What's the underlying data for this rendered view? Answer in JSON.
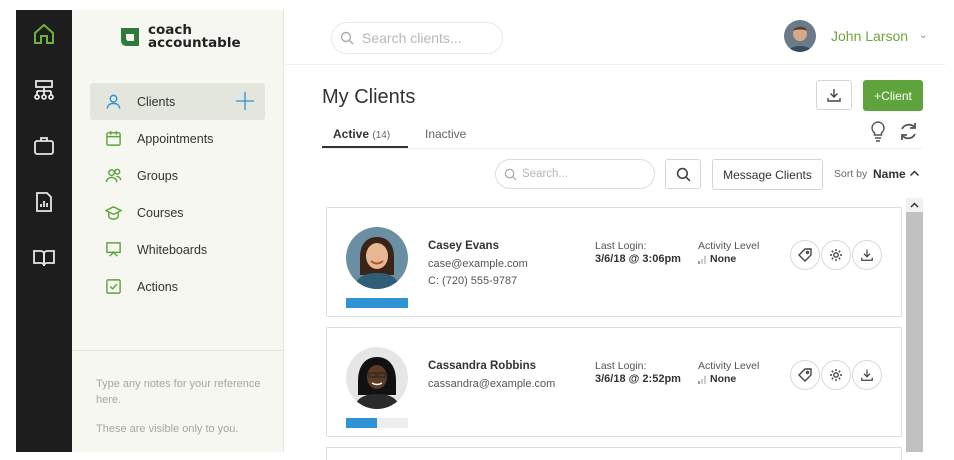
{
  "colors": {
    "accent": "#5ea33b",
    "rail": "#1d1d1d",
    "sidebar": "#f5f7f0",
    "progress": "#2d93d4",
    "user_name": "#6fa43e"
  },
  "brand": {
    "name": "coach\naccountable",
    "icon": "coachaccountable-logo-icon"
  },
  "rail": {
    "icons": [
      "home-icon",
      "org-chart-icon",
      "briefcase-icon",
      "report-icon",
      "book-icon"
    ]
  },
  "sidebar": {
    "items": [
      {
        "label": "Clients",
        "icon": "user-icon",
        "active": true
      },
      {
        "label": "Appointments",
        "icon": "calendar-icon"
      },
      {
        "label": "Groups",
        "icon": "group-icon"
      },
      {
        "label": "Courses",
        "icon": "graduation-cap-icon"
      },
      {
        "label": "Whiteboards",
        "icon": "whiteboard-icon"
      },
      {
        "label": "Actions",
        "icon": "checkbox-icon"
      }
    ],
    "notes_placeholder": "Type any notes for your reference here.",
    "notes_visibility": "These are visible only to you."
  },
  "header": {
    "search_placeholder": "Search clients...",
    "user_name": "John Larson"
  },
  "main": {
    "title": "My Clients",
    "add_client_label": "+Client",
    "tabs": [
      {
        "label": "Active",
        "count": "(14)",
        "active": true
      },
      {
        "label": "Inactive"
      }
    ],
    "list_search_placeholder": "Search...",
    "message_clients_label": "Message Clients",
    "sort_by_label": "Sort by",
    "sort_value": "Name"
  },
  "clients": [
    {
      "name": "Casey Evans",
      "email": "case@example.com",
      "phone": "C: (720) 555-9787",
      "last_login_label": "Last Login:",
      "last_login": "3/6/18 @ 3:06pm",
      "activity_label": "Activity Level",
      "activity": "None",
      "progress": 1.0
    },
    {
      "name": "Cassandra Robbins",
      "email": "cassandra@example.com",
      "phone": "",
      "last_login_label": "Last Login:",
      "last_login": "3/6/18 @ 2:52pm",
      "activity_label": "Activity Level",
      "activity": "None",
      "progress": 0.5
    }
  ]
}
